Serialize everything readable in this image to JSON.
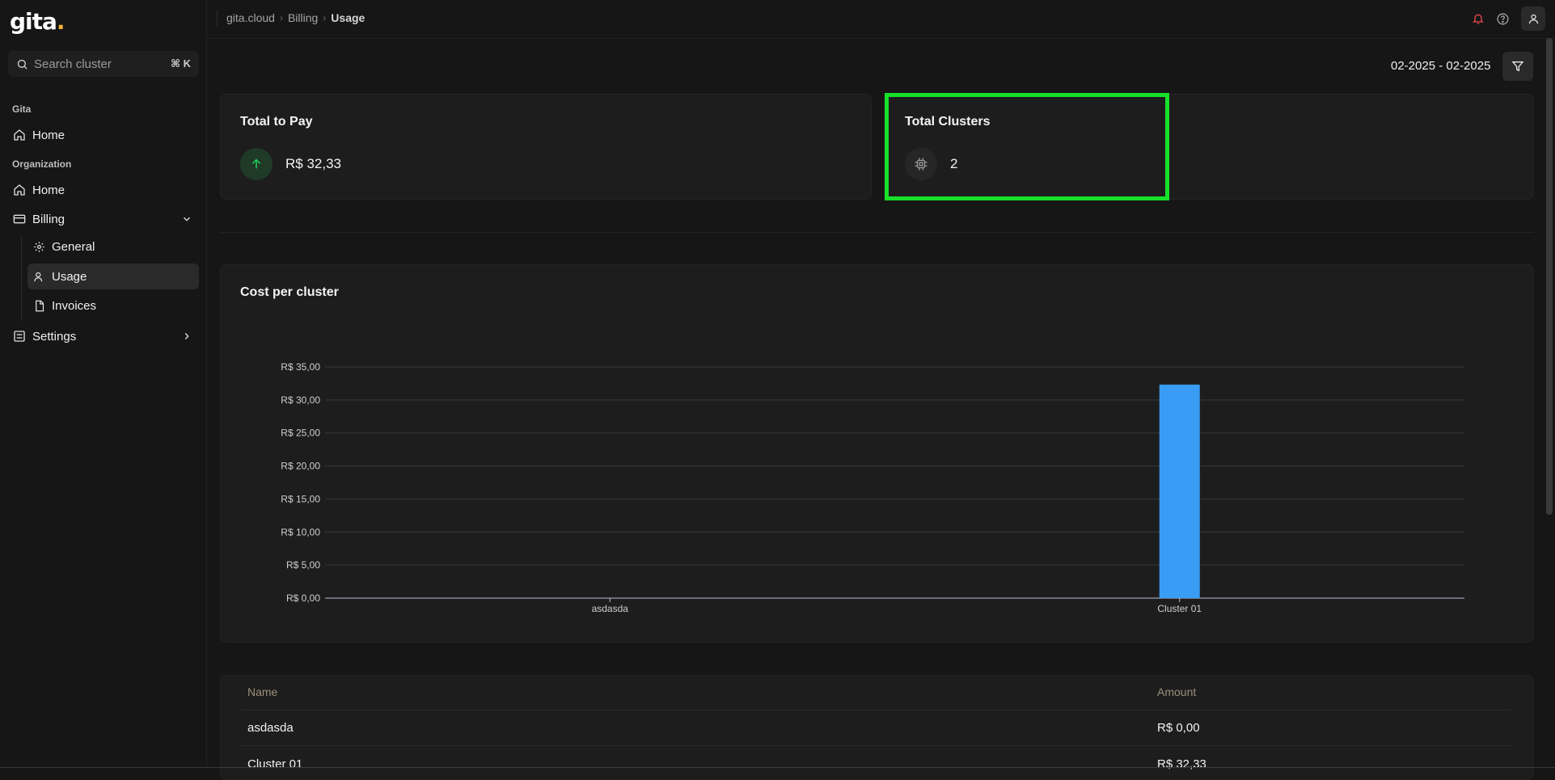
{
  "app": {
    "logo": "gita",
    "logo_dot": "."
  },
  "search": {
    "placeholder": "Search cluster",
    "shortcut": "⌘ K"
  },
  "sidebar": {
    "section_gita": "Gita",
    "home_1": "Home",
    "section_org": "Organization",
    "home_2": "Home",
    "billing": "Billing",
    "general": "General",
    "usage": "Usage",
    "invoices": "Invoices",
    "settings": "Settings"
  },
  "breadcrumb": {
    "root": "gita.cloud",
    "parent": "Billing",
    "current": "Usage"
  },
  "filter": {
    "date_range": "02-2025 - 02-2025"
  },
  "cards": {
    "total_to_pay": {
      "title": "Total to Pay",
      "value": "R$ 32,33"
    },
    "total_clusters": {
      "title": "Total Clusters",
      "value": "2"
    }
  },
  "chart_title": "Cost per cluster",
  "chart_data": {
    "type": "bar",
    "title": "Cost per cluster",
    "categories": [
      "asdasda",
      "Cluster 01"
    ],
    "values": [
      0,
      32.33
    ],
    "ylim": [
      0,
      35
    ],
    "yticks": [
      "R$ 0,00",
      "R$ 5,00",
      "R$ 10,00",
      "R$ 15,00",
      "R$ 20,00",
      "R$ 25,00",
      "R$ 30,00",
      "R$ 35,00"
    ],
    "grid": true,
    "bar_color": "#3a9df5"
  },
  "table": {
    "headers": {
      "name": "Name",
      "amount": "Amount"
    },
    "rows": [
      {
        "name": "asdasda",
        "amount": "R$ 0,00"
      },
      {
        "name": "Cluster 01",
        "amount": "R$ 32,33"
      }
    ]
  },
  "colors": {
    "accent_green": "#17e02a",
    "up_arrow": "#22c55e",
    "bell": "#e5484d"
  }
}
